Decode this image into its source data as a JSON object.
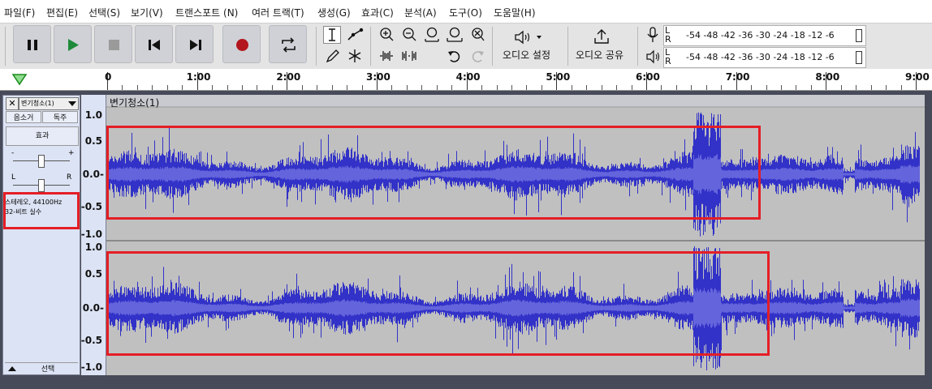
{
  "menu": [
    "파일(F)",
    "편집(E)",
    "선택(S)",
    "보기(V)",
    "트랜스포트 (N)",
    "여러 트랙(T)",
    "생성(G)",
    "효과(C)",
    "분석(A)",
    "도구(O)",
    "도움말(H)"
  ],
  "toolbar": {
    "pause_icon": "pause-icon",
    "play_icon": "play-icon",
    "stop_icon": "stop-icon",
    "skip_start_icon": "skip-start-icon",
    "skip_end_icon": "skip-end-icon",
    "record_icon": "record-icon",
    "loop_icon": "loop-icon",
    "audio_setup": "오디오 설정",
    "share_audio": "오디오 공유",
    "record_meter": {
      "l": "L",
      "r": "R",
      "scale": "-54 -48 -42 -36 -30 -24 -18 -12 -6"
    },
    "play_meter": {
      "l": "L",
      "r": "R",
      "scale": "-54 -48 -42 -36 -30 -24 -18 -12 -6"
    }
  },
  "timeline": {
    "ticks": [
      {
        "label": "0",
        "sec": 0
      },
      {
        "label": "1:00",
        "sec": 60
      },
      {
        "label": "2:00",
        "sec": 120
      },
      {
        "label": "3:00",
        "sec": 180
      },
      {
        "label": "4:00",
        "sec": 240
      },
      {
        "label": "5:00",
        "sec": 300
      },
      {
        "label": "6:00",
        "sec": 360
      },
      {
        "label": "7:00",
        "sec": 420
      },
      {
        "label": "8:00",
        "sec": 480
      },
      {
        "label": "9:00",
        "sec": 540
      }
    ]
  },
  "track": {
    "name_menu": "변기청소(1)",
    "mute": "음소거",
    "solo": "독주",
    "effects": "효과",
    "gain_minus": "-",
    "gain_plus": "+",
    "pan_left": "L",
    "pan_right": "R",
    "info_line1": "스테레오, 44100Hz",
    "info_line2": "32-비트 실수",
    "select": "선택",
    "clip_title": "변기청소(1)",
    "scale_top": [
      "1.0",
      "0.5",
      "0.0-",
      "-0.5",
      "-1.0"
    ],
    "scale_bottom": [
      "1.0",
      "0.5",
      "0.0-",
      "-0.5",
      "-1.0"
    ],
    "colors": {
      "wave": "#3232c8",
      "rms": "#6464dc",
      "clip_bg": "#c0c0c0",
      "highlight": "#e41e26"
    }
  }
}
